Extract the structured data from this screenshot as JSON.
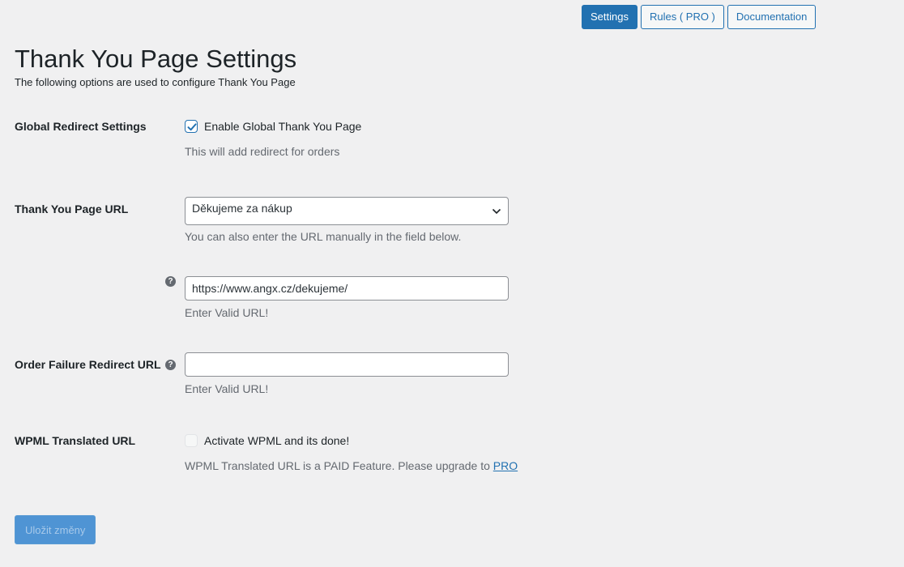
{
  "nav": {
    "settings": "Settings",
    "rules": "Rules ( PRO )",
    "documentation": "Documentation"
  },
  "header": {
    "title": "Thank You Page Settings",
    "subtitle": "The following options are used to configure Thank You Page"
  },
  "global_redirect": {
    "label": "Global Redirect Settings",
    "checkbox_label": "Enable Global Thank You Page",
    "checked": true,
    "description": "This will add redirect for orders"
  },
  "thank_you_url": {
    "label": "Thank You Page URL",
    "selected_option": "Děkujeme za nákup",
    "select_description": "You can also enter the URL manually in the field below.",
    "help_icon": "?",
    "url_value": "https://www.angx.cz/dekujeme/",
    "url_description": "Enter Valid URL!"
  },
  "order_failure": {
    "label": "Order Failure Redirect URL",
    "help_icon": "?",
    "url_value": "",
    "url_description": "Enter Valid URL!"
  },
  "wpml": {
    "label": "WPML Translated URL",
    "checkbox_label": "Activate WPML and its done!",
    "checked": false,
    "description_prefix": "WPML Translated URL is a PAID Feature. Please upgrade to ",
    "pro_link": "PRO"
  },
  "footer": {
    "save_label": "Uložit změny"
  },
  "colors": {
    "accent": "#2271b1",
    "background": "#f0f0f1",
    "save_disabled": "#4f94d4"
  }
}
